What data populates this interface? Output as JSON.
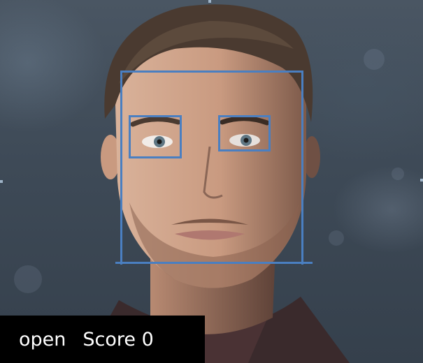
{
  "overlay": {
    "box_color": "#4a7fc1"
  },
  "status": {
    "state_label": "open",
    "score_label": "Score 0"
  },
  "colors": {
    "status_background": "#000000",
    "status_text": "#ffffff"
  }
}
